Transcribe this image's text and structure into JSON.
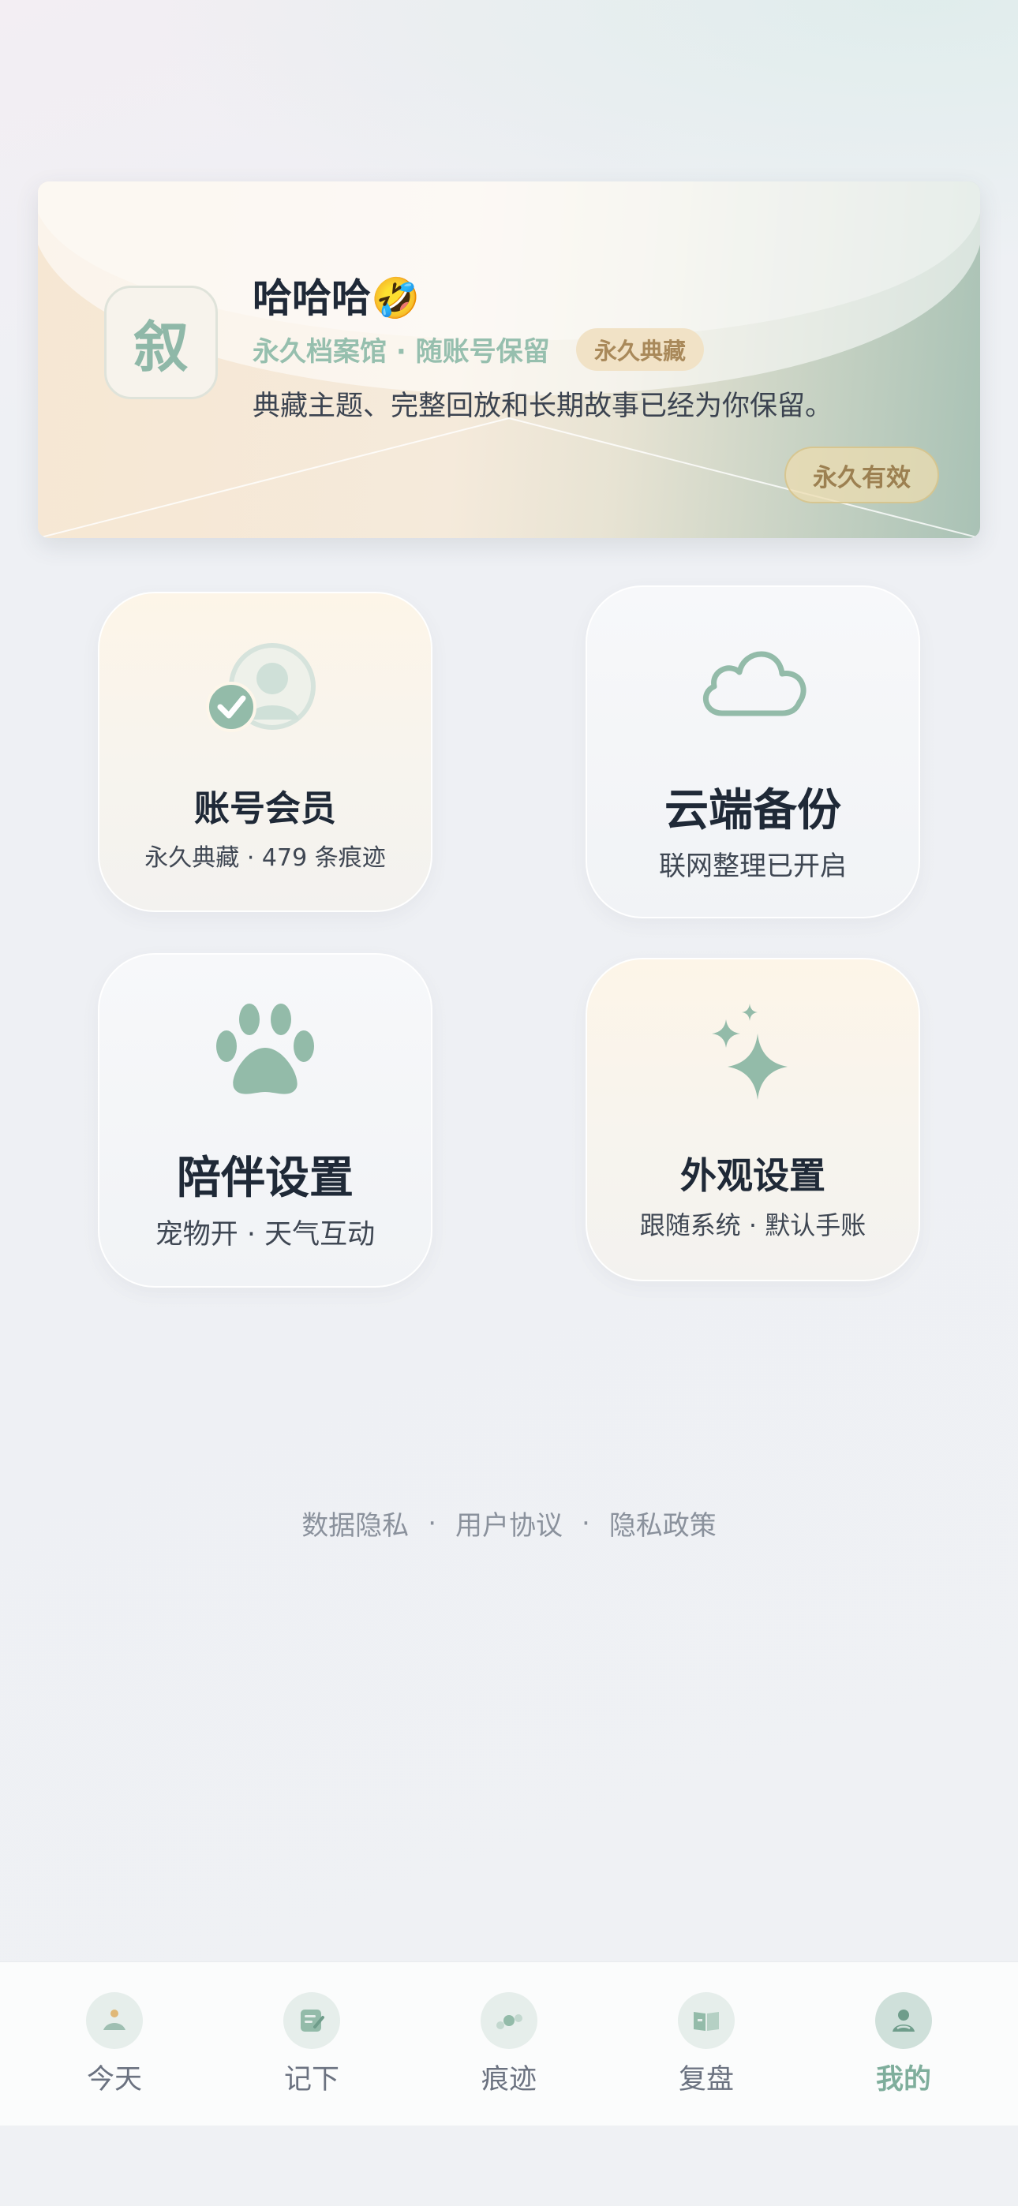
{
  "profile": {
    "avatar_char": "叙",
    "name": "哈哈哈🤣",
    "subtitle": "永久档案馆 · 随账号保留",
    "badge": "永久典藏",
    "description": "典藏主题、完整回放和长期故事已经为你保留。",
    "validity": "永久有效"
  },
  "tiles": {
    "account": {
      "title": "账号会员",
      "subtitle": "永久典藏 · 479 条痕迹",
      "icon": "user-check-icon"
    },
    "cloud": {
      "title": "云端备份",
      "subtitle": "联网整理已开启",
      "icon": "cloud-icon"
    },
    "pet": {
      "title": "陪伴设置",
      "subtitle": "宠物开 · 天气互动",
      "icon": "paw-icon"
    },
    "appearance": {
      "title": "外观设置",
      "subtitle": "跟随系统 · 默认手账",
      "icon": "sparkles-icon"
    }
  },
  "footer": {
    "links": [
      "数据隐私",
      "用户协议",
      "隐私政策"
    ],
    "separator": "·"
  },
  "tabbar": {
    "tabs": [
      {
        "label": "今天",
        "icon": "today-icon"
      },
      {
        "label": "记下",
        "icon": "note-icon"
      },
      {
        "label": "痕迹",
        "icon": "traces-icon"
      },
      {
        "label": "复盘",
        "icon": "review-book-icon"
      },
      {
        "label": "我的",
        "icon": "profile-icon"
      }
    ],
    "active": "我的"
  },
  "colors": {
    "accent": "#8fbaa9",
    "active_tab": "#7fae9c",
    "badge_text": "#a9895a"
  }
}
